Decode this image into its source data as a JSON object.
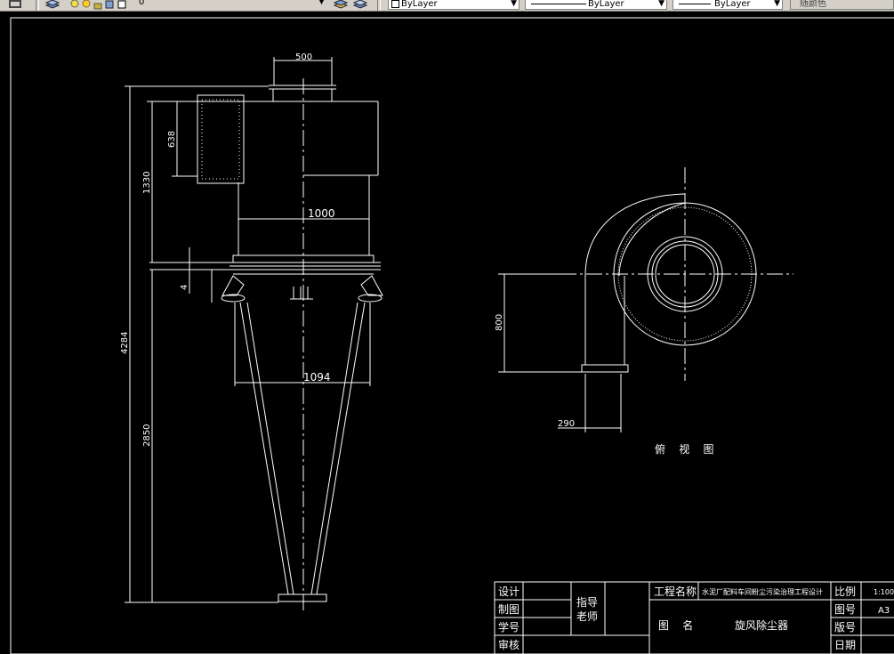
{
  "toolbar": {
    "layer_value": "0",
    "color_value": "ByLayer",
    "linetype_value": "ByLayer",
    "lineweight_value": "ByLayer",
    "plotstyle_value": "随颜色"
  },
  "drawing": {
    "dims": {
      "d500": "500",
      "d638": "638",
      "d1330": "1330",
      "d1000": "1000",
      "d4": "4",
      "d4284": "4284",
      "d1094": "1094",
      "d2850": "2850",
      "d800": "800",
      "d290": "290"
    },
    "view_label": "俯    视    图"
  },
  "title_block": {
    "design": "设计",
    "draw": "制图",
    "student_id": "学号",
    "review": "审核",
    "advisor": "指导老师",
    "project_name_label": "工程名称",
    "project_name_value": "水泥厂配料车间粉尘污染治理工程设计",
    "drawing_name_label": "图    名",
    "drawing_name_value": "旋风除尘器",
    "scale_label": "比例",
    "scale_value": "1:100",
    "drawing_no_label": "图号",
    "drawing_no_value": "A3",
    "version_label": "版号",
    "date_label": "日期"
  },
  "colors": {
    "background": "#000000",
    "lines": "#ffffff",
    "toolbar": "#d4d0c8"
  }
}
